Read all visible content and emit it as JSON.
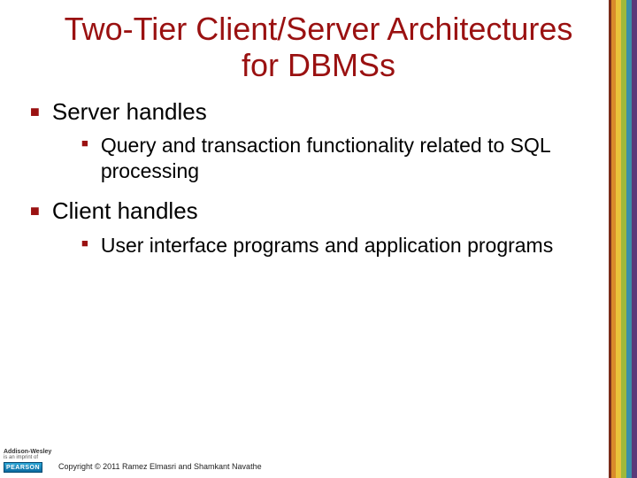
{
  "title": "Two-Tier Client/Server Architectures for DBMSs",
  "bullets": [
    {
      "text": "Server handles",
      "children": [
        {
          "text": "Query and transaction functionality related to SQL processing"
        }
      ]
    },
    {
      "text": "Client handles",
      "children": [
        {
          "text": "User interface programs and application programs"
        }
      ]
    }
  ],
  "publisher": {
    "line1": "Addison-Wesley",
    "line2": "is an imprint of",
    "badge": "PEARSON"
  },
  "copyright": "Copyright © 2011 Ramez Elmasri and Shamkant Navathe"
}
